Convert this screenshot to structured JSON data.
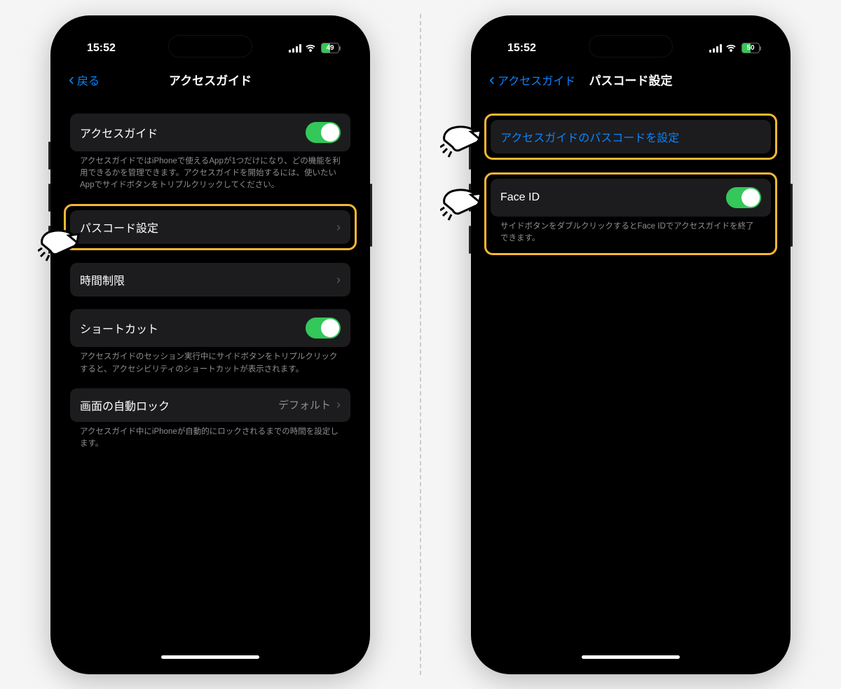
{
  "left": {
    "status": {
      "time": "15:52",
      "battery": "49"
    },
    "nav": {
      "back": "戻る",
      "title": "アクセスガイド"
    },
    "row_guided_access": {
      "label": "アクセスガイド"
    },
    "caption_guided_access": "アクセスガイドではiPhoneで使えるAppが1つだけになり、どの機能を利用できるかを管理できます。アクセスガイドを開始するには、使いたいAppでサイドボタンをトリプルクリックしてください。",
    "row_passcode": {
      "label": "パスコード設定"
    },
    "row_timelimit": {
      "label": "時間制限"
    },
    "row_shortcut": {
      "label": "ショートカット"
    },
    "caption_shortcut": "アクセスガイドのセッション実行中にサイドボタンをトリプルクリックすると、アクセシビリティのショートカットが表示されます。",
    "row_autolock": {
      "label": "画面の自動ロック",
      "value": "デフォルト"
    },
    "caption_autolock": "アクセスガイド中にiPhoneが自動的にロックされるまでの時間を設定します。"
  },
  "right": {
    "status": {
      "time": "15:52",
      "battery": "50"
    },
    "nav": {
      "back": "アクセスガイド",
      "title": "パスコード設定"
    },
    "row_set_passcode": {
      "label": "アクセスガイドのパスコードを設定"
    },
    "row_faceid": {
      "label": "Face ID"
    },
    "caption_faceid": "サイドボタンをダブルクリックするとFace IDでアクセスガイドを終了できます。"
  }
}
